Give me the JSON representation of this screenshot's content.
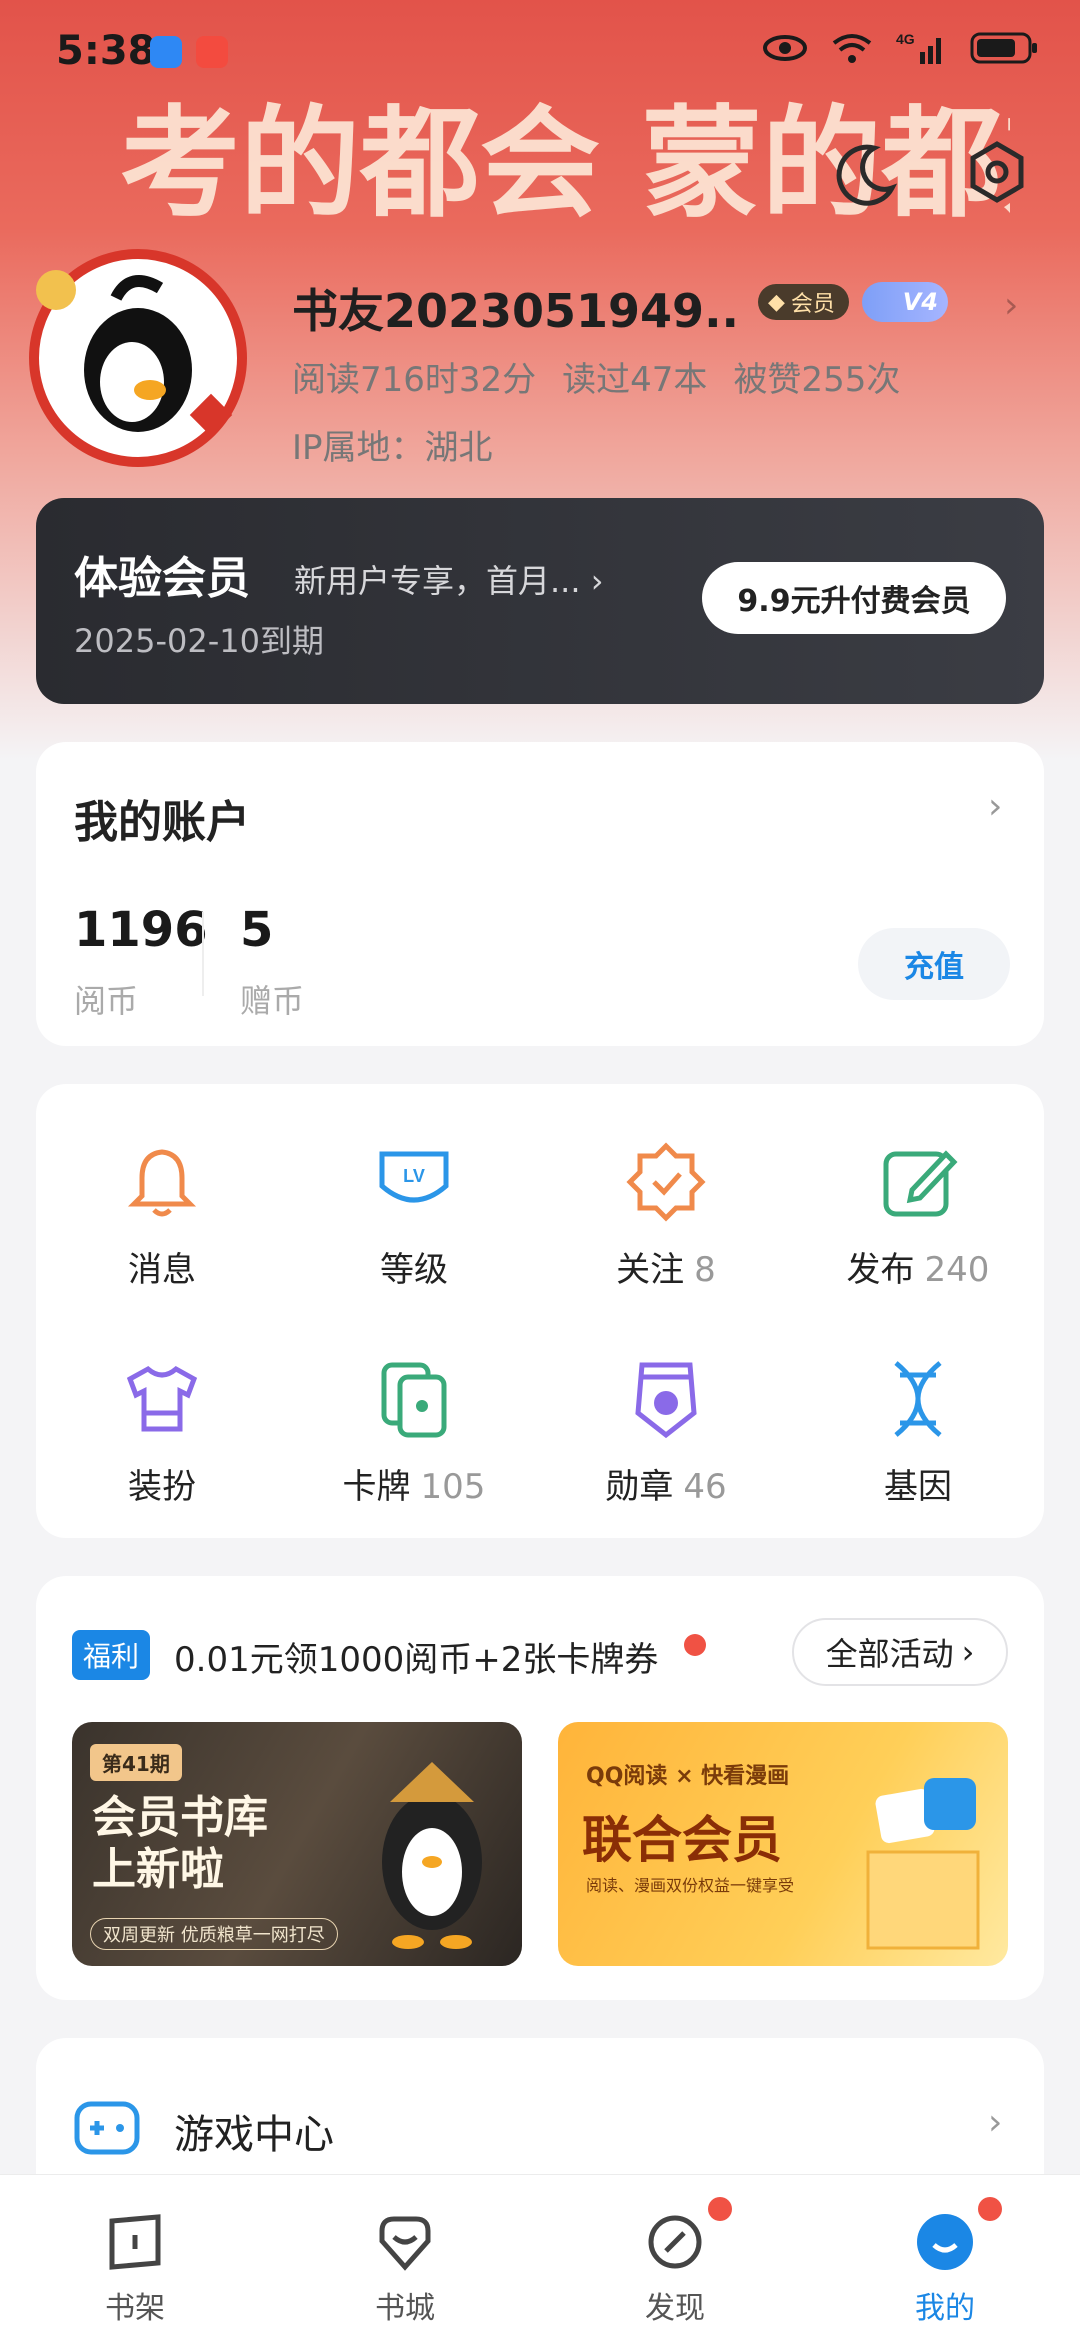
{
  "status_bar": {
    "time": "5:38",
    "network": "4G"
  },
  "hero": {
    "art_text": "考的都会 蒙的都对"
  },
  "profile": {
    "username": "书友2023051949...",
    "vip_badge": "会员",
    "level_badge": "V4",
    "stats": [
      "阅读716时32分",
      "读过47本",
      "被赞255次"
    ],
    "ip_location": "IP属地：湖北"
  },
  "vip_card": {
    "title": "体验会员",
    "description": "新用户专享，首月...",
    "expire": "2025-02-10到期",
    "upgrade_label": "9.9元升付费会员"
  },
  "account": {
    "title": "我的账户",
    "coins": {
      "value": "1196",
      "label": "阅币"
    },
    "gift_coins": {
      "value": "5",
      "label": "赠币"
    },
    "recharge_label": "充值"
  },
  "features": [
    {
      "label": "消息",
      "count": ""
    },
    {
      "label": "等级",
      "count": ""
    },
    {
      "label": "关注",
      "count": "8"
    },
    {
      "label": "发布",
      "count": "240"
    },
    {
      "label": "装扮",
      "count": ""
    },
    {
      "label": "卡牌",
      "count": "105"
    },
    {
      "label": "勋章",
      "count": "46"
    },
    {
      "label": "基因",
      "count": ""
    }
  ],
  "promo": {
    "tag": "福利",
    "headline": "0.01元领1000阅币+2张卡牌券",
    "all_label": "全部活动",
    "banner1": {
      "issue": "第41期",
      "line1": "会员书库",
      "line2": "上新啦",
      "footer": "双周更新  优质粮草一网打尽"
    },
    "banner2": {
      "top": "QQ阅读 × 快看漫画",
      "title": "联合会员",
      "footer": "阅读、漫画双份权益一键享受"
    }
  },
  "game_center": {
    "title": "游戏中心"
  },
  "bottom_nav": [
    {
      "label": "书架"
    },
    {
      "label": "书城"
    },
    {
      "label": "发现"
    },
    {
      "label": "我的"
    }
  ],
  "colors": {
    "accent": "#1b87e5",
    "badge_red": "#f05244",
    "hero_red": "#e2534a"
  }
}
